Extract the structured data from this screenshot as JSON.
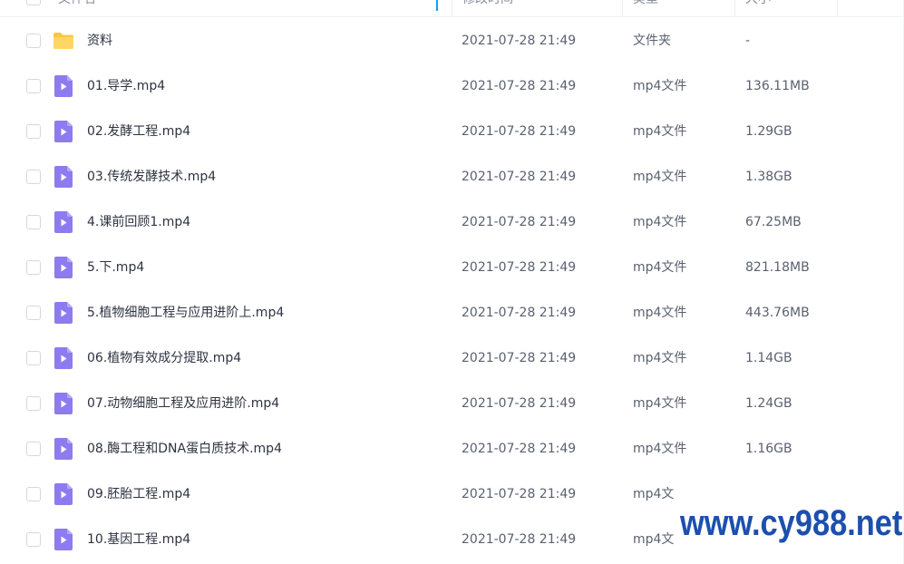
{
  "header": {
    "col_name": "文件名",
    "col_time": "修改时间",
    "col_type": "类型",
    "col_size": "大小"
  },
  "files": [
    {
      "name": "资料",
      "time": "2021-07-28 21:49",
      "type": "文件夹",
      "size": "-",
      "icon": "folder-icon"
    },
    {
      "name": "01.导学.mp4",
      "time": "2021-07-28 21:49",
      "type": "mp4文件",
      "size": "136.11MB",
      "icon": "video-file-icon"
    },
    {
      "name": "02.发酵工程.mp4",
      "time": "2021-07-28 21:49",
      "type": "mp4文件",
      "size": "1.29GB",
      "icon": "video-file-icon"
    },
    {
      "name": "03.传统发酵技术.mp4",
      "time": "2021-07-28 21:49",
      "type": "mp4文件",
      "size": "1.38GB",
      "icon": "video-file-icon"
    },
    {
      "name": "4.课前回顾1.mp4",
      "time": "2021-07-28 21:49",
      "type": "mp4文件",
      "size": "67.25MB",
      "icon": "video-file-icon"
    },
    {
      "name": "5.下.mp4",
      "time": "2021-07-28 21:49",
      "type": "mp4文件",
      "size": "821.18MB",
      "icon": "video-file-icon"
    },
    {
      "name": "5.植物细胞工程与应用进阶上.mp4",
      "time": "2021-07-28 21:49",
      "type": "mp4文件",
      "size": "443.76MB",
      "icon": "video-file-icon"
    },
    {
      "name": "06.植物有效成分提取.mp4",
      "time": "2021-07-28 21:49",
      "type": "mp4文件",
      "size": "1.14GB",
      "icon": "video-file-icon"
    },
    {
      "name": "07.动物细胞工程及应用进阶.mp4",
      "time": "2021-07-28 21:49",
      "type": "mp4文件",
      "size": "1.24GB",
      "icon": "video-file-icon"
    },
    {
      "name": "08.酶工程和DNA蛋白质技术.mp4",
      "time": "2021-07-28 21:49",
      "type": "mp4文件",
      "size": "1.16GB",
      "icon": "video-file-icon"
    },
    {
      "name": "09.胚胎工程.mp4",
      "time": "2021-07-28 21:49",
      "type": "mp4文",
      "size": "",
      "icon": "video-file-icon"
    },
    {
      "name": "10.基因工程.mp4",
      "time": "2021-07-28 21:49",
      "type": "mp4文",
      "size": "",
      "icon": "video-file-icon"
    }
  ],
  "watermark": "www.cy988.net",
  "colors": {
    "folder": "#ffc53d",
    "video": "#8c7cf0",
    "accent": "#06a7ff",
    "watermark": "#1c4fae"
  }
}
